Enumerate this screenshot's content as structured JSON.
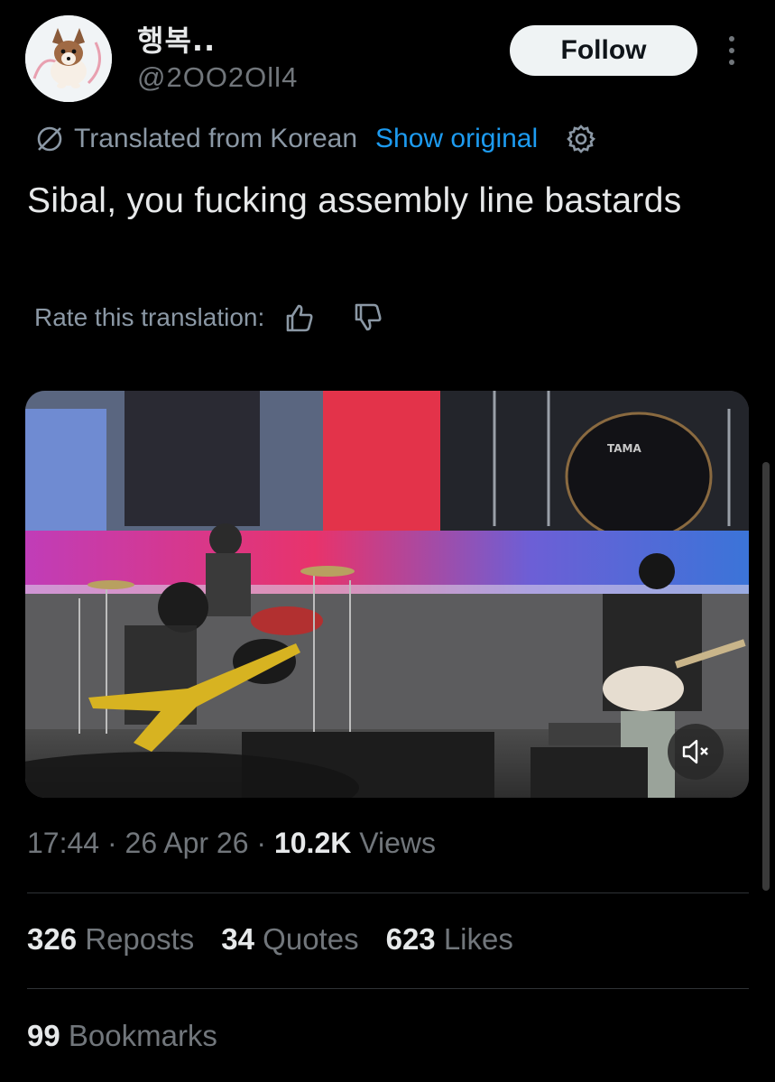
{
  "author": {
    "display_name": "행복..",
    "handle": "@2OO2Oll4",
    "avatar_icon": "chihuahua-avatar"
  },
  "follow_button": {
    "label": "Follow"
  },
  "more_menu": {
    "icon": "more-vertical-icon"
  },
  "translation": {
    "icon": "globe-slash-icon",
    "label": "Translated from Korean",
    "show_original": "Show original",
    "settings_icon": "gear-icon"
  },
  "tweet": {
    "text": "Sibal, you fucking assembly line bastards"
  },
  "rate": {
    "label": "Rate this translation:",
    "up_icon": "thumbs-up-icon",
    "down_icon": "thumbs-down-icon"
  },
  "media": {
    "type": "video",
    "drum_brand": "TAMA",
    "mute_icon": "volume-muted-icon"
  },
  "meta": {
    "time": "17:44",
    "sep1": " · ",
    "date": "26 Apr 26",
    "sep2": " · ",
    "views_count": "10.2K",
    "views_label": " Views"
  },
  "stats": {
    "reposts_count": "326",
    "reposts_label": " Reposts",
    "quotes_count": "34",
    "quotes_label": " Quotes",
    "likes_count": "623",
    "likes_label": " Likes",
    "bookmarks_count": "99",
    "bookmarks_label": " Bookmarks"
  },
  "colors": {
    "background": "#000000",
    "text_primary": "#e7e9ea",
    "text_secondary": "#71767b",
    "link": "#1d9bf0",
    "divider": "#2f3336"
  }
}
